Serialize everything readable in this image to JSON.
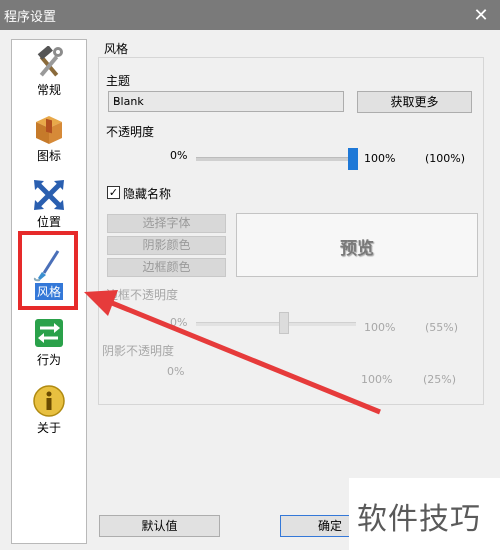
{
  "window": {
    "title": "程序设置",
    "close_symbol": "✕"
  },
  "sidebar": {
    "items": [
      {
        "label": "常规",
        "icon": "hammer-wrench-icon"
      },
      {
        "label": "图标",
        "icon": "package-box-icon"
      },
      {
        "label": "位置",
        "icon": "move-arrows-icon"
      },
      {
        "label": "风格",
        "icon": "brush-icon",
        "active": true
      },
      {
        "label": "行为",
        "icon": "switch-arrows-icon"
      },
      {
        "label": "关于",
        "icon": "info-icon"
      }
    ]
  },
  "style_panel": {
    "section_title": "风格",
    "theme_label": "主题",
    "theme_value": "Blank",
    "get_more_label": "获取更多",
    "opacity_label": "不透明度",
    "opacity_min": "0%",
    "opacity_max": "100%",
    "opacity_current": "(100%)",
    "opacity_level": 1.0,
    "hide_name_label": "隐藏名称",
    "hide_name_checked": true,
    "choose_font_label": "选择字体",
    "shadow_color_label": "阴影颜色",
    "border_color_label": "边框颜色",
    "preview_text": "预览",
    "border_opacity_label": "边框不透明度",
    "border_opacity_min": "0%",
    "border_opacity_max": "100%",
    "border_opacity_current": "(55%)",
    "border_opacity_level": 0.55,
    "shadow_opacity_label": "阴影不透明度",
    "shadow_opacity_min": "0%",
    "shadow_opacity_max": "100%",
    "shadow_opacity_current": "(25%)"
  },
  "footer": {
    "default_label": "默认值",
    "ok_label": "确定"
  },
  "watermark": {
    "text": "软件技巧"
  },
  "colors": {
    "accent": "#1e78d7",
    "highlight_red": "#e62a2a",
    "titlebar": "#7a7a7a"
  }
}
